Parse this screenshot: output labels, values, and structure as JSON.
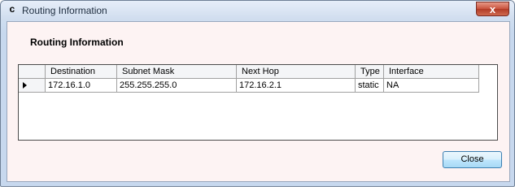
{
  "window": {
    "title": "Routing Information",
    "icon_glyph": "c",
    "close_glyph": "x"
  },
  "section": {
    "heading": "Routing Information"
  },
  "table": {
    "columns": [
      "Destination",
      "Subnet Mask",
      "Next Hop",
      "Type",
      "Interface"
    ],
    "rows": [
      [
        "172.16.1.0",
        "255.255.255.0",
        "172.16.2.1",
        "static",
        "NA"
      ]
    ]
  },
  "buttons": {
    "close_label": "Close"
  },
  "colors": {
    "client_background": "#fdf3f3",
    "close_button_red": "#c8513c",
    "button_blue": "#bee6fd"
  }
}
